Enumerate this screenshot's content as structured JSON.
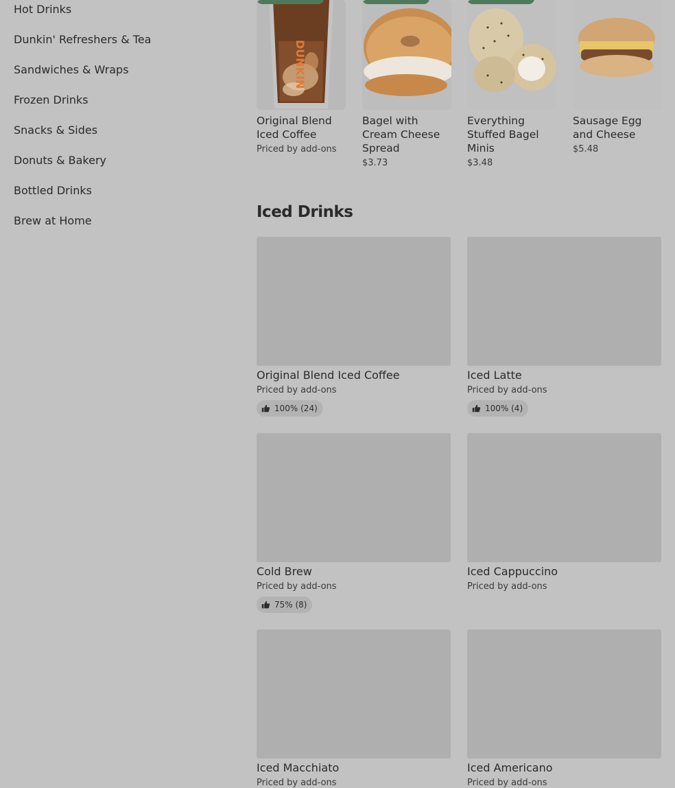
{
  "sidebar": {
    "items": [
      {
        "label": "Hot Drinks"
      },
      {
        "label": "Dunkin' Refreshers & Tea"
      },
      {
        "label": "Sandwiches & Wraps"
      },
      {
        "label": "Frozen Drinks"
      },
      {
        "label": "Snacks & Sides"
      },
      {
        "label": "Donuts & Bakery"
      },
      {
        "label": "Bottled Drinks"
      },
      {
        "label": "Brew at Home"
      }
    ]
  },
  "featured": {
    "items": [
      {
        "title": "Original Blend Iced Coffee",
        "price": "Priced by add-ons",
        "image": "iced-coffee-cup"
      },
      {
        "title": "Bagel with Cream Cheese Spread",
        "price": "$3.73",
        "image": "bagel-cream-cheese"
      },
      {
        "title": "Everything Stuffed Bagel Minis",
        "price": "$3.48",
        "image": "stuffed-bagel-minis"
      },
      {
        "title": "Sausage Egg and Cheese",
        "price": "$5.48",
        "image": "sausage-egg-cheese-sandwich"
      }
    ],
    "badge_color": "#4e7a5b"
  },
  "section": {
    "title": "Iced Drinks",
    "items": [
      {
        "title": "Original Blend Iced Coffee",
        "price": "Priced by add-ons",
        "rating": "100% (24)"
      },
      {
        "title": "Iced Latte",
        "price": "Priced by add-ons",
        "rating": "100% (4)"
      },
      {
        "title": "Cold Brew",
        "price": "Priced by add-ons",
        "rating": "75% (8)"
      },
      {
        "title": "Iced Cappuccino",
        "price": "Priced by add-ons",
        "rating": ""
      },
      {
        "title": "Iced Macchiato",
        "price": "Priced by add-ons",
        "rating": ""
      },
      {
        "title": "Iced Americano",
        "price": "Priced by add-ons",
        "rating": ""
      }
    ]
  },
  "icons": {
    "rating": "thumbs-up-icon"
  }
}
